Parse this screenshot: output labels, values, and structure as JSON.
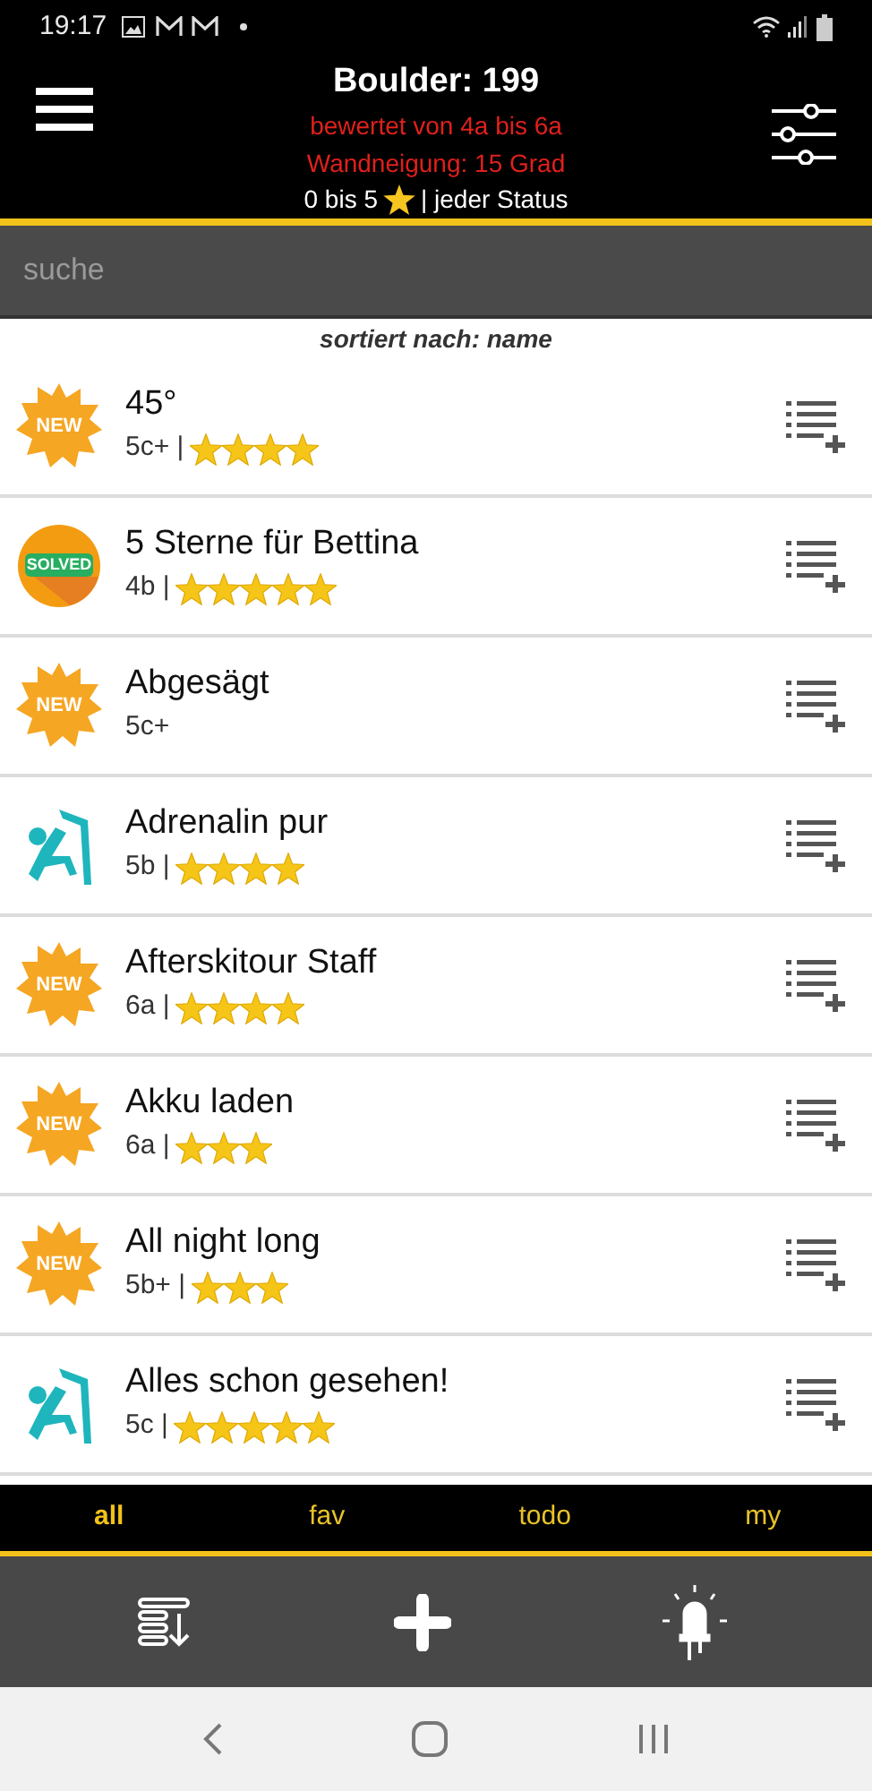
{
  "status_bar": {
    "time": "19:17"
  },
  "header": {
    "title": "Boulder: 199",
    "filter_grade": "bewertet von 4a bis 6a",
    "filter_angle": "Wandneigung: 15 Grad",
    "filter_stars_prefix": "0 bis 5",
    "filter_status": "| jeder Status"
  },
  "search": {
    "placeholder": "suche"
  },
  "sort_label": "sortiert nach: name",
  "boulders": [
    {
      "kind": "new",
      "badge": "NEW",
      "name": "45°",
      "meta": "5c+ |",
      "stars": 4
    },
    {
      "kind": "solved",
      "badge": "SOLVED",
      "name": "5 Sterne für Bettina",
      "meta": "4b |",
      "stars": 5
    },
    {
      "kind": "new",
      "badge": "NEW",
      "name": "Abgesägt",
      "meta": "5c+"
    },
    {
      "kind": "climber",
      "name": "Adrenalin pur",
      "meta": "5b |",
      "stars": 4
    },
    {
      "kind": "new",
      "badge": "NEW",
      "name": "Afterskitour Staff",
      "meta": "6a |",
      "stars": 4
    },
    {
      "kind": "new",
      "badge": "NEW",
      "name": "Akku laden",
      "meta": "6a |",
      "stars": 3
    },
    {
      "kind": "new",
      "badge": "NEW",
      "name": "All night long",
      "meta": "5b+ |",
      "stars": 3
    },
    {
      "kind": "climber",
      "name": "Alles schon gesehen!",
      "meta": "5c |",
      "stars": 5
    }
  ],
  "tabs": [
    {
      "label": "all",
      "selected": true
    },
    {
      "label": "fav",
      "selected": false
    },
    {
      "label": "todo",
      "selected": false
    },
    {
      "label": "my",
      "selected": false
    }
  ]
}
